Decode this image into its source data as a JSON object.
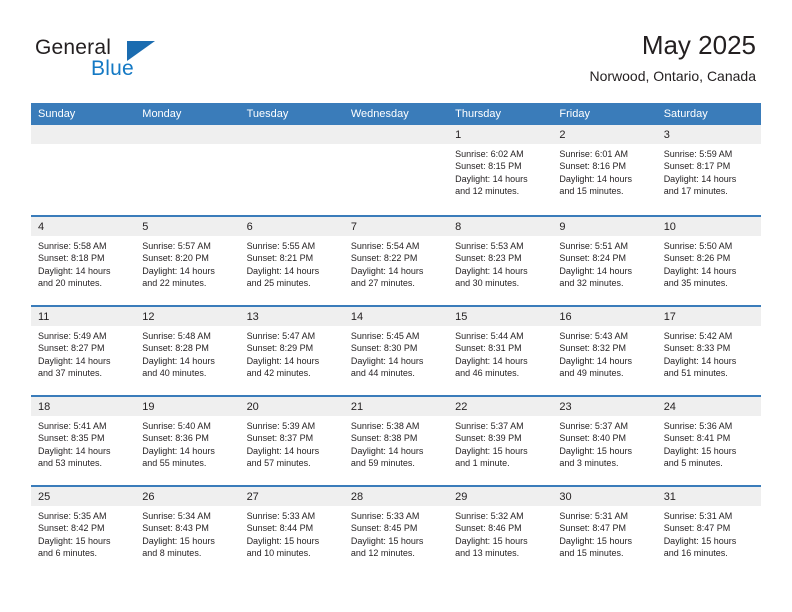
{
  "brand": {
    "name_top": "General",
    "name_bottom": "Blue",
    "accent_color": "#1479c4",
    "triangle_color": "#1b6cb0"
  },
  "header": {
    "title": "May 2025",
    "subtitle": "Norwood, Ontario, Canada"
  },
  "theme": {
    "header_row_bg": "#3a7cba",
    "daynum_band_bg": "#efefef",
    "row_divider": "#3a7cba",
    "text": "#231f20"
  },
  "weekdays": [
    "Sunday",
    "Monday",
    "Tuesday",
    "Wednesday",
    "Thursday",
    "Friday",
    "Saturday"
  ],
  "weeks": [
    [
      {
        "day": "",
        "lines": []
      },
      {
        "day": "",
        "lines": []
      },
      {
        "day": "",
        "lines": []
      },
      {
        "day": "",
        "lines": []
      },
      {
        "day": "1",
        "lines": [
          "Sunrise: 6:02 AM",
          "Sunset: 8:15 PM",
          "Daylight: 14 hours",
          "and 12 minutes."
        ]
      },
      {
        "day": "2",
        "lines": [
          "Sunrise: 6:01 AM",
          "Sunset: 8:16 PM",
          "Daylight: 14 hours",
          "and 15 minutes."
        ]
      },
      {
        "day": "3",
        "lines": [
          "Sunrise: 5:59 AM",
          "Sunset: 8:17 PM",
          "Daylight: 14 hours",
          "and 17 minutes."
        ]
      }
    ],
    [
      {
        "day": "4",
        "lines": [
          "Sunrise: 5:58 AM",
          "Sunset: 8:18 PM",
          "Daylight: 14 hours",
          "and 20 minutes."
        ]
      },
      {
        "day": "5",
        "lines": [
          "Sunrise: 5:57 AM",
          "Sunset: 8:20 PM",
          "Daylight: 14 hours",
          "and 22 minutes."
        ]
      },
      {
        "day": "6",
        "lines": [
          "Sunrise: 5:55 AM",
          "Sunset: 8:21 PM",
          "Daylight: 14 hours",
          "and 25 minutes."
        ]
      },
      {
        "day": "7",
        "lines": [
          "Sunrise: 5:54 AM",
          "Sunset: 8:22 PM",
          "Daylight: 14 hours",
          "and 27 minutes."
        ]
      },
      {
        "day": "8",
        "lines": [
          "Sunrise: 5:53 AM",
          "Sunset: 8:23 PM",
          "Daylight: 14 hours",
          "and 30 minutes."
        ]
      },
      {
        "day": "9",
        "lines": [
          "Sunrise: 5:51 AM",
          "Sunset: 8:24 PM",
          "Daylight: 14 hours",
          "and 32 minutes."
        ]
      },
      {
        "day": "10",
        "lines": [
          "Sunrise: 5:50 AM",
          "Sunset: 8:26 PM",
          "Daylight: 14 hours",
          "and 35 minutes."
        ]
      }
    ],
    [
      {
        "day": "11",
        "lines": [
          "Sunrise: 5:49 AM",
          "Sunset: 8:27 PM",
          "Daylight: 14 hours",
          "and 37 minutes."
        ]
      },
      {
        "day": "12",
        "lines": [
          "Sunrise: 5:48 AM",
          "Sunset: 8:28 PM",
          "Daylight: 14 hours",
          "and 40 minutes."
        ]
      },
      {
        "day": "13",
        "lines": [
          "Sunrise: 5:47 AM",
          "Sunset: 8:29 PM",
          "Daylight: 14 hours",
          "and 42 minutes."
        ]
      },
      {
        "day": "14",
        "lines": [
          "Sunrise: 5:45 AM",
          "Sunset: 8:30 PM",
          "Daylight: 14 hours",
          "and 44 minutes."
        ]
      },
      {
        "day": "15",
        "lines": [
          "Sunrise: 5:44 AM",
          "Sunset: 8:31 PM",
          "Daylight: 14 hours",
          "and 46 minutes."
        ]
      },
      {
        "day": "16",
        "lines": [
          "Sunrise: 5:43 AM",
          "Sunset: 8:32 PM",
          "Daylight: 14 hours",
          "and 49 minutes."
        ]
      },
      {
        "day": "17",
        "lines": [
          "Sunrise: 5:42 AM",
          "Sunset: 8:33 PM",
          "Daylight: 14 hours",
          "and 51 minutes."
        ]
      }
    ],
    [
      {
        "day": "18",
        "lines": [
          "Sunrise: 5:41 AM",
          "Sunset: 8:35 PM",
          "Daylight: 14 hours",
          "and 53 minutes."
        ]
      },
      {
        "day": "19",
        "lines": [
          "Sunrise: 5:40 AM",
          "Sunset: 8:36 PM",
          "Daylight: 14 hours",
          "and 55 minutes."
        ]
      },
      {
        "day": "20",
        "lines": [
          "Sunrise: 5:39 AM",
          "Sunset: 8:37 PM",
          "Daylight: 14 hours",
          "and 57 minutes."
        ]
      },
      {
        "day": "21",
        "lines": [
          "Sunrise: 5:38 AM",
          "Sunset: 8:38 PM",
          "Daylight: 14 hours",
          "and 59 minutes."
        ]
      },
      {
        "day": "22",
        "lines": [
          "Sunrise: 5:37 AM",
          "Sunset: 8:39 PM",
          "Daylight: 15 hours",
          "and 1 minute."
        ]
      },
      {
        "day": "23",
        "lines": [
          "Sunrise: 5:37 AM",
          "Sunset: 8:40 PM",
          "Daylight: 15 hours",
          "and 3 minutes."
        ]
      },
      {
        "day": "24",
        "lines": [
          "Sunrise: 5:36 AM",
          "Sunset: 8:41 PM",
          "Daylight: 15 hours",
          "and 5 minutes."
        ]
      }
    ],
    [
      {
        "day": "25",
        "lines": [
          "Sunrise: 5:35 AM",
          "Sunset: 8:42 PM",
          "Daylight: 15 hours",
          "and 6 minutes."
        ]
      },
      {
        "day": "26",
        "lines": [
          "Sunrise: 5:34 AM",
          "Sunset: 8:43 PM",
          "Daylight: 15 hours",
          "and 8 minutes."
        ]
      },
      {
        "day": "27",
        "lines": [
          "Sunrise: 5:33 AM",
          "Sunset: 8:44 PM",
          "Daylight: 15 hours",
          "and 10 minutes."
        ]
      },
      {
        "day": "28",
        "lines": [
          "Sunrise: 5:33 AM",
          "Sunset: 8:45 PM",
          "Daylight: 15 hours",
          "and 12 minutes."
        ]
      },
      {
        "day": "29",
        "lines": [
          "Sunrise: 5:32 AM",
          "Sunset: 8:46 PM",
          "Daylight: 15 hours",
          "and 13 minutes."
        ]
      },
      {
        "day": "30",
        "lines": [
          "Sunrise: 5:31 AM",
          "Sunset: 8:47 PM",
          "Daylight: 15 hours",
          "and 15 minutes."
        ]
      },
      {
        "day": "31",
        "lines": [
          "Sunrise: 5:31 AM",
          "Sunset: 8:47 PM",
          "Daylight: 15 hours",
          "and 16 minutes."
        ]
      }
    ]
  ]
}
